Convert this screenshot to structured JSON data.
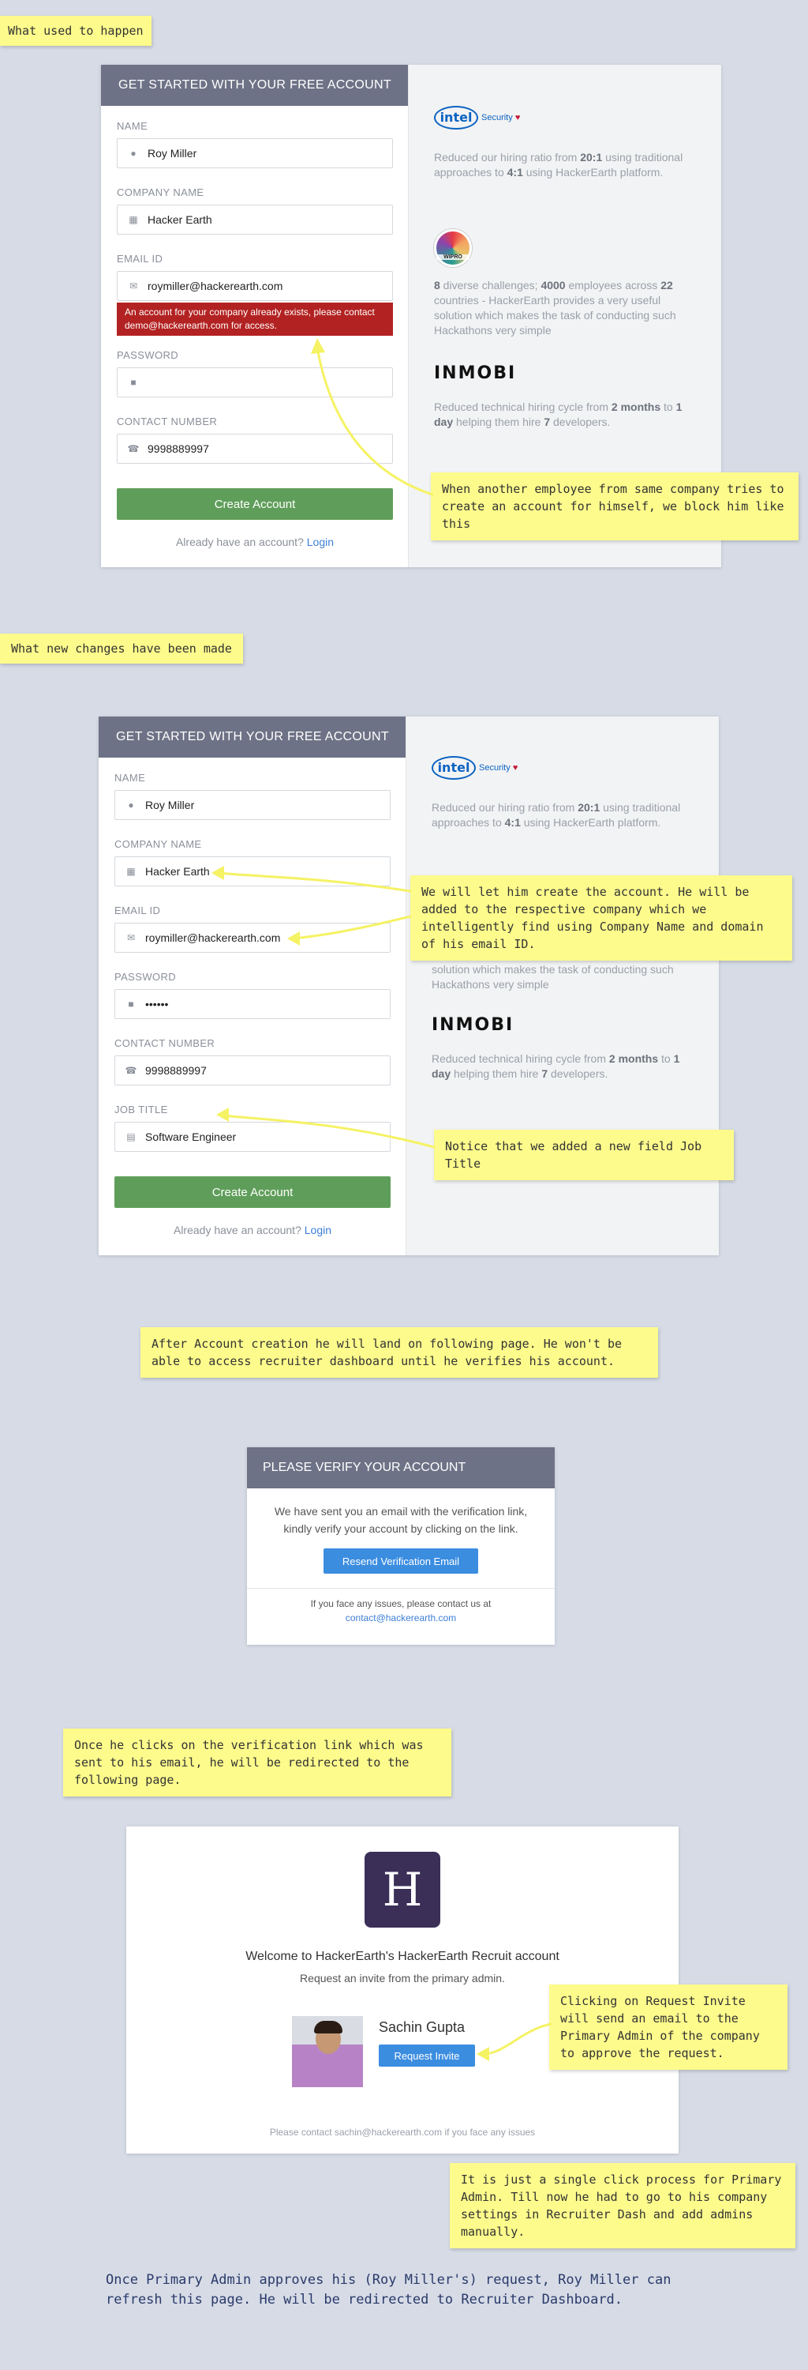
{
  "labels": {
    "before": "What used to happen",
    "after": "What new changes have been made"
  },
  "form": {
    "header": "GET STARTED WITH YOUR FREE ACCOUNT",
    "name_label": "NAME",
    "name_value": "Roy Miller",
    "company_label": "COMPANY NAME",
    "company_value": "Hacker Earth",
    "email_label": "EMAIL ID",
    "email_value": "roymiller@hackerearth.com",
    "email_error": "An account for your company already exists, please contact demo@hackerearth.com for access.",
    "password_label": "PASSWORD",
    "password_value": "••••••",
    "contact_label": "CONTACT NUMBER",
    "contact_value": "9998889997",
    "jobtitle_label": "JOB TITLE",
    "jobtitle_value": "Software Engineer",
    "create_button": "Create Account",
    "have_account": "Already have an account?",
    "login_link": "Login"
  },
  "testimonials": {
    "intel_logo": "intel",
    "intel_security": "Security",
    "intel_text_pre": "Reduced our hiring ratio from ",
    "intel_b1": "20:1",
    "intel_mid": " using traditional approaches to ",
    "intel_b2": "4:1",
    "intel_post": " using HackerEarth platform.",
    "wipro_logo": "WIPRO",
    "wipro_b1": "8",
    "wipro_t1": " diverse challenges; ",
    "wipro_b2": "4000",
    "wipro_t2": " employees across ",
    "wipro_b3": "22",
    "wipro_t3": " countries - HackerEarth provides a very useful solution which makes the task of conducting such Hackathons very simple",
    "wipro_tail": "countries - HackerEarth provides a very useful solution which makes the task of conducting such Hackathons very simple",
    "inmobi_logo": "INMOBI",
    "inmobi_t1": "Reduced technical hiring cycle from ",
    "inmobi_b1": "2 months",
    "inmobi_t2": " to ",
    "inmobi_b2": "1 day",
    "inmobi_t3": " helping them hire ",
    "inmobi_b3": "7",
    "inmobi_t4": " developers."
  },
  "notes": {
    "block": "When another employee from same company tries to create an account for himself, we block him like this",
    "allow": "We will let him create the account. He will be added to the respective company which we intelligently find using Company Name and domain of his email ID.",
    "jobtitle": "Notice that we added a new field Job Title",
    "after_creation": "After Account creation he will land on following page. He won't be able to access recruiter dashboard until he verifies his account.",
    "verification": "Once he clicks on the verification link which was sent to his email, he will be redirected to the following page.",
    "request_invite": "Clicking on Request Invite will send an email to the Primary Admin of the company to approve the request.",
    "single_click": "It is just a single click process for Primary Admin. Till now he had to go to his company settings in Recruiter Dash and add admins manually.",
    "final": "Once Primary Admin approves his (Roy Miller's) request, Roy Miller can refresh this page. He will be redirected to Recruiter Dashboard."
  },
  "verify": {
    "header": "PLEASE VERIFY YOUR ACCOUNT",
    "message": "We have sent you an email with the verification link, kindly verify your account by clicking on the link.",
    "resend_button": "Resend Verification Email",
    "footer": "If you face any issues, please contact us at",
    "contact_email": "contact@hackerearth.com"
  },
  "invite": {
    "logo_letter": "H",
    "welcome": "Welcome to HackerEarth's HackerEarth Recruit account",
    "request_text": "Request an invite from the primary admin.",
    "admin_name": "Sachin Gupta",
    "invite_button": "Request Invite",
    "footer": "Please contact sachin@hackerearth.com if you face any issues"
  },
  "icons": {
    "user": "user-icon",
    "building": "building-icon",
    "envelope": "envelope-icon",
    "lock": "lock-icon",
    "phone": "phone-icon",
    "briefcase": "briefcase-icon"
  },
  "colors": {
    "background": "#d6dbe6",
    "header": "#6e7286",
    "create_button": "#5f9e5a",
    "error": "#b32222",
    "note": "#fdfb8c",
    "link": "#3d7fd6",
    "primary_button": "#3b8de0"
  }
}
